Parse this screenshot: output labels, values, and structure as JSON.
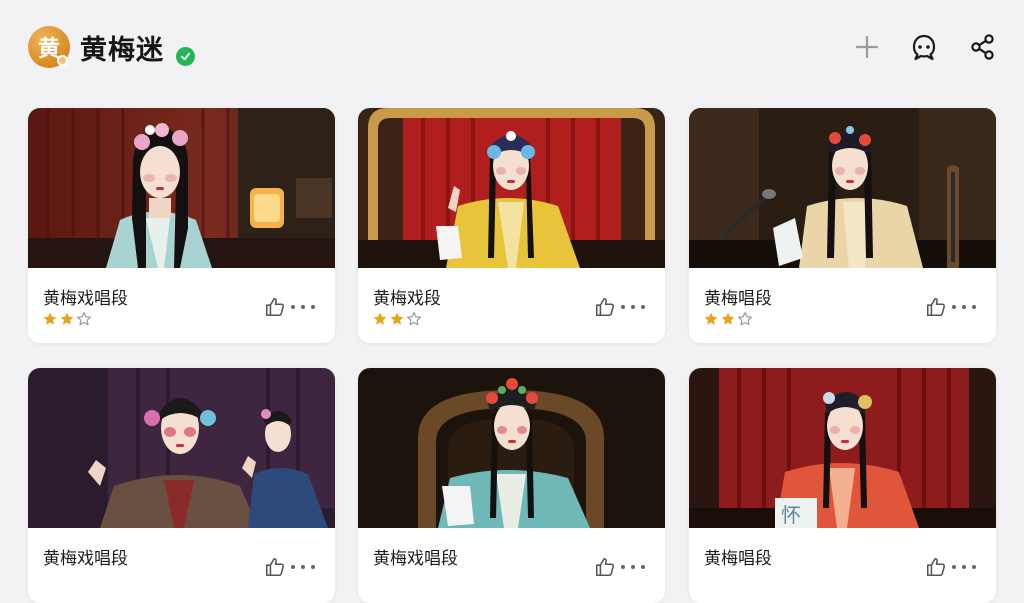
{
  "header": {
    "avatar_char": "黄",
    "title": "黄梅迷",
    "verified": true,
    "actions": [
      "plus-icon",
      "chatbot-icon",
      "share-icon"
    ]
  },
  "colors": {
    "avatar": "#d98a22",
    "verified": "#22b55a",
    "star_filled": "#e8a317",
    "star_empty": "#9a9a9a",
    "background": "#f2f2f4"
  },
  "cards": [
    {
      "title": "黄梅戏唱段",
      "rating": 2,
      "max_rating": 3
    },
    {
      "title": "黄梅戏段",
      "rating": 2,
      "max_rating": 3
    },
    {
      "title": "黄梅唱段",
      "rating": 2,
      "max_rating": 3
    },
    {
      "title": "黄梅戏唱段"
    },
    {
      "title": "黄梅戏唱段"
    },
    {
      "title": "黄梅唱段"
    }
  ]
}
